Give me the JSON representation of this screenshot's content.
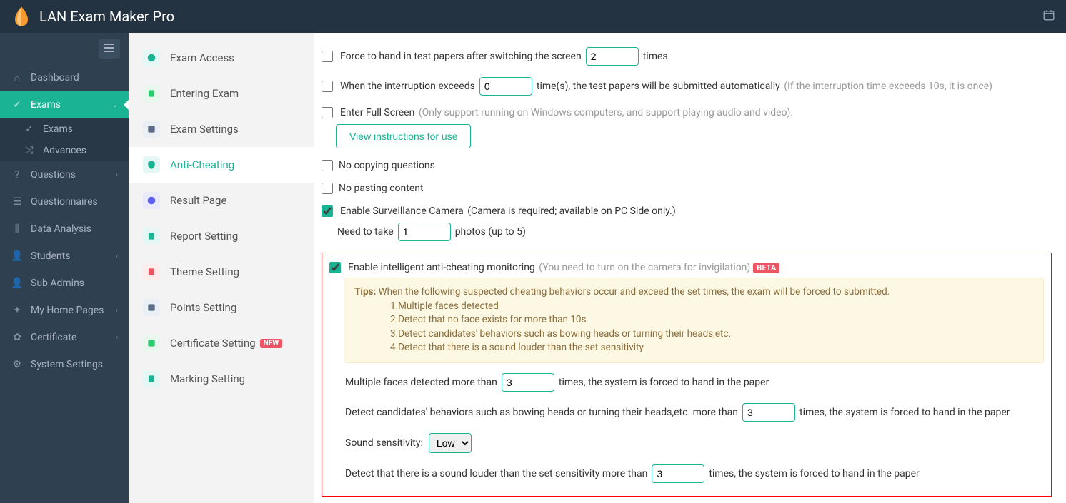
{
  "header": {
    "title": "LAN Exam Maker Pro"
  },
  "sidebar": {
    "items": [
      {
        "label": "Dashboard"
      },
      {
        "label": "Exams"
      },
      {
        "label": "Questions"
      },
      {
        "label": "Questionnaires"
      },
      {
        "label": "Data Analysis"
      },
      {
        "label": "Students"
      },
      {
        "label": "Sub Admins"
      },
      {
        "label": "My Home Pages"
      },
      {
        "label": "Certificate"
      },
      {
        "label": "System Settings"
      }
    ],
    "sub": [
      {
        "label": "Exams"
      },
      {
        "label": "Advances"
      }
    ]
  },
  "subsidebar": {
    "items": [
      {
        "label": "Exam Access"
      },
      {
        "label": "Entering Exam"
      },
      {
        "label": "Exam Settings"
      },
      {
        "label": "Anti-Cheating"
      },
      {
        "label": "Result Page"
      },
      {
        "label": "Report Setting"
      },
      {
        "label": "Theme Setting"
      },
      {
        "label": "Points Setting"
      },
      {
        "label": "Certificate Setting",
        "badge": "NEW"
      },
      {
        "label": "Marking Setting"
      }
    ]
  },
  "form": {
    "forceHandIn": {
      "prefix": "Force to hand in test papers after switching the screen",
      "value": "2",
      "suffix": "times"
    },
    "interruption": {
      "prefix": "When the interruption exceeds",
      "value": "0",
      "suffix": "time(s), the test papers will be submitted automatically",
      "hint": "(If the interruption time exceeds 10s, it is once)"
    },
    "fullscreen": {
      "label": "Enter Full Screen",
      "hint": "(Only support running on Windows computers, and support playing audio and video).",
      "button": "View instructions for use"
    },
    "noCopy": "No copying questions",
    "noPaste": "No pasting content",
    "camera": {
      "label": "Enable Surveillance Camera",
      "hint": "(Camera is required;  available on PC Side only.)",
      "need": "Need to take",
      "photos": "1",
      "suffix": "photos (up to 5)"
    },
    "intelligent": {
      "label": "Enable intelligent anti-cheating monitoring",
      "hint": "(You need to turn on the camera for invigilation)",
      "beta": "BETA",
      "tipsLabel": "Tips:",
      "tipsIntro": "When the following suspected cheating behaviors occur and exceed the set times, the exam will be forced to submitted.",
      "tips": [
        "1.Multiple faces detected",
        "2.Detect that no face exists for more than 10s",
        "3.Detect candidates' behaviors such as bowing heads or turning their heads,etc.",
        "4.Detect that there is a sound louder than the set sensitivity"
      ],
      "multiFaces": {
        "prefix": "Multiple faces detected more than",
        "value": "3",
        "suffix": "times, the system is forced to hand in the paper"
      },
      "behaviors": {
        "prefix": "Detect candidates' behaviors such as bowing heads or turning their heads,etc. more than",
        "value": "3",
        "suffix": "times, the system is forced to hand in the paper"
      },
      "sensitivity": {
        "label": "Sound sensitivity:",
        "value": "Low"
      },
      "sound": {
        "prefix": "Detect that there is a sound louder than the set sensitivity more than",
        "value": "3",
        "suffix": "times, the system is forced to hand in the paper"
      }
    }
  }
}
